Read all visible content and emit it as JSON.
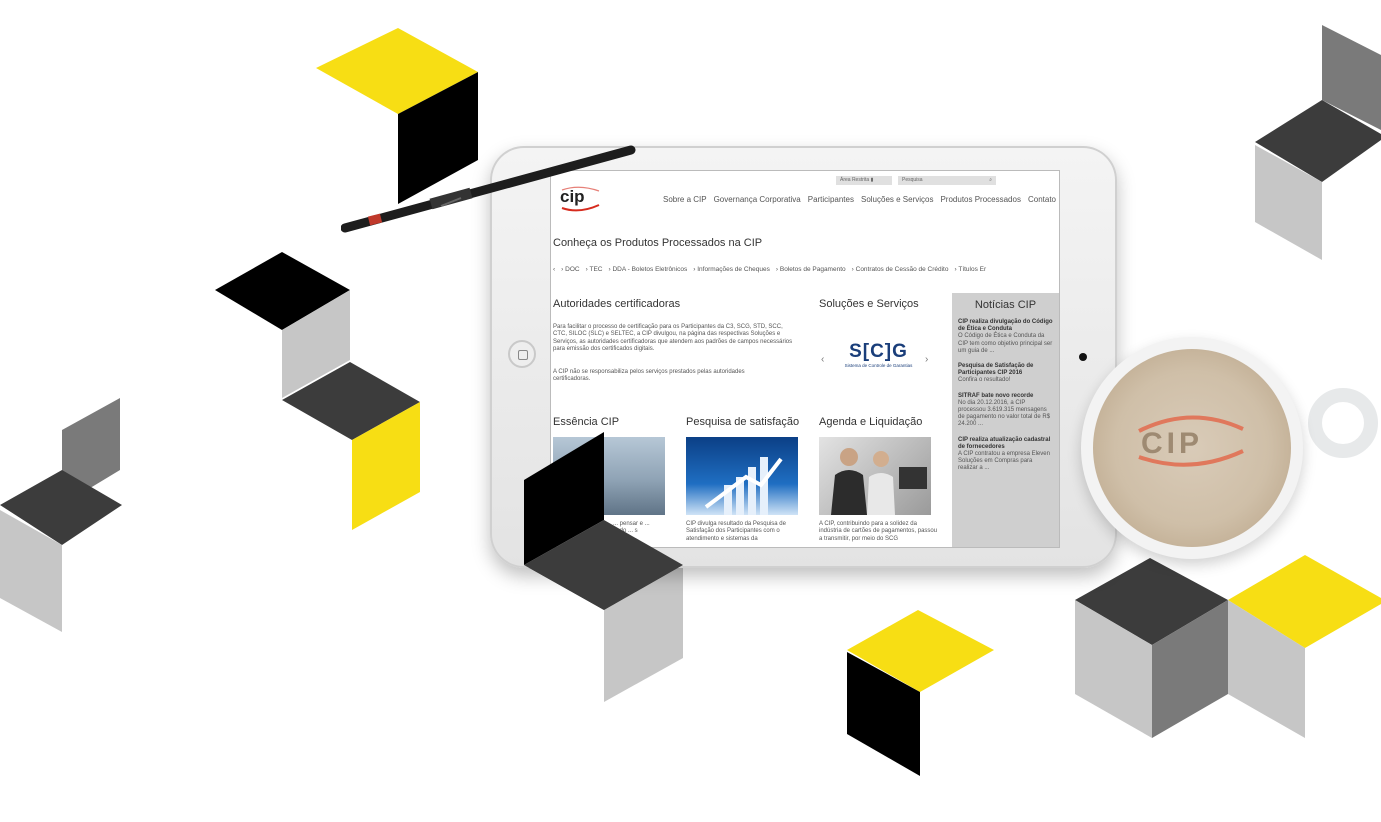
{
  "colors": {
    "yellow": "#f7de14",
    "black": "#000000",
    "dark": "#3c3c3c",
    "mid": "#7a7a7a",
    "light": "#c6c6c6",
    "cip_red": "#d62b1e",
    "scg_blue": "#1a3e7a"
  },
  "site": {
    "topbar": {
      "area_restrita": "Área Restrita",
      "search_placeholder": "Pesquisa"
    },
    "logo": "cip",
    "nav": [
      "Sobre a CIP",
      "Governança Corporativa",
      "Participantes",
      "Soluções e Serviços",
      "Produtos Processados",
      "Contato"
    ],
    "produtos_heading": "Conheça os Produtos Processados na CIP",
    "tabs": [
      "DOC",
      "TEC",
      "DDA - Boletos Eletrônicos",
      "Informações de Cheques",
      "Boletos de Pagamento",
      "Contratos de Cessão de Crédito",
      "Títulos Er"
    ],
    "autoridades": {
      "heading": "Autoridades certificadoras",
      "p1": "Para facilitar o processo de certificação para os Participantes da C3, SCG, STD, SCC, CTC, SILOC (SLC) e SELTEC, a CIP divulgou, na página das respectivas Soluções e Serviços, as autoridades certificadoras que atendem aos padrões de campos necessários para emissão dos certificados digitais.",
      "p2": "A CIP não se responsabiliza pelos serviços prestados pelas autoridades certificadoras."
    },
    "solucoes": {
      "heading": "Soluções e Serviços",
      "scg_logo": "S[C]G",
      "scg_caption": "Sistema de Controle de Garantias"
    },
    "noticias": {
      "heading": "Notícias CIP",
      "items": [
        {
          "title": "CIP realiza divulgação do Código de Ética e Conduta",
          "body": "O Código de Ética e Conduta da CIP tem como objetivo principal ser um guia de ..."
        },
        {
          "title": "Pesquisa de Satisfação de Participantes CIP 2016",
          "body": "Confira o resultado!"
        },
        {
          "title": "SITRAF bate novo recorde",
          "body": "No dia 20.12.2016, a CIP processou 3.619.315 mensagens de pagamento no valor total de R$ 24.200 ..."
        },
        {
          "title": "CIP realiza atualização cadastral de fornecedores",
          "body": "A CIP contratou a empresa Eleven Soluções em Compras para realizar a ..."
        }
      ]
    },
    "essencia": {
      "heading": "Essência CIP",
      "text": "... pensar e ... ondo ... s"
    },
    "pesquisa": {
      "heading": "Pesquisa de satisfação",
      "text": "CIP divulga resultado da Pesquisa de Satisfação dos Participantes com o atendimento e sistemas da"
    },
    "agenda": {
      "heading": "Agenda e Liquidação",
      "text": "A CIP, contribuindo para a solidez da indústria de cartões de pagamentos, passou a transmitir, por meio do SCG"
    }
  },
  "mug": {
    "foam_logo": "CIP"
  }
}
